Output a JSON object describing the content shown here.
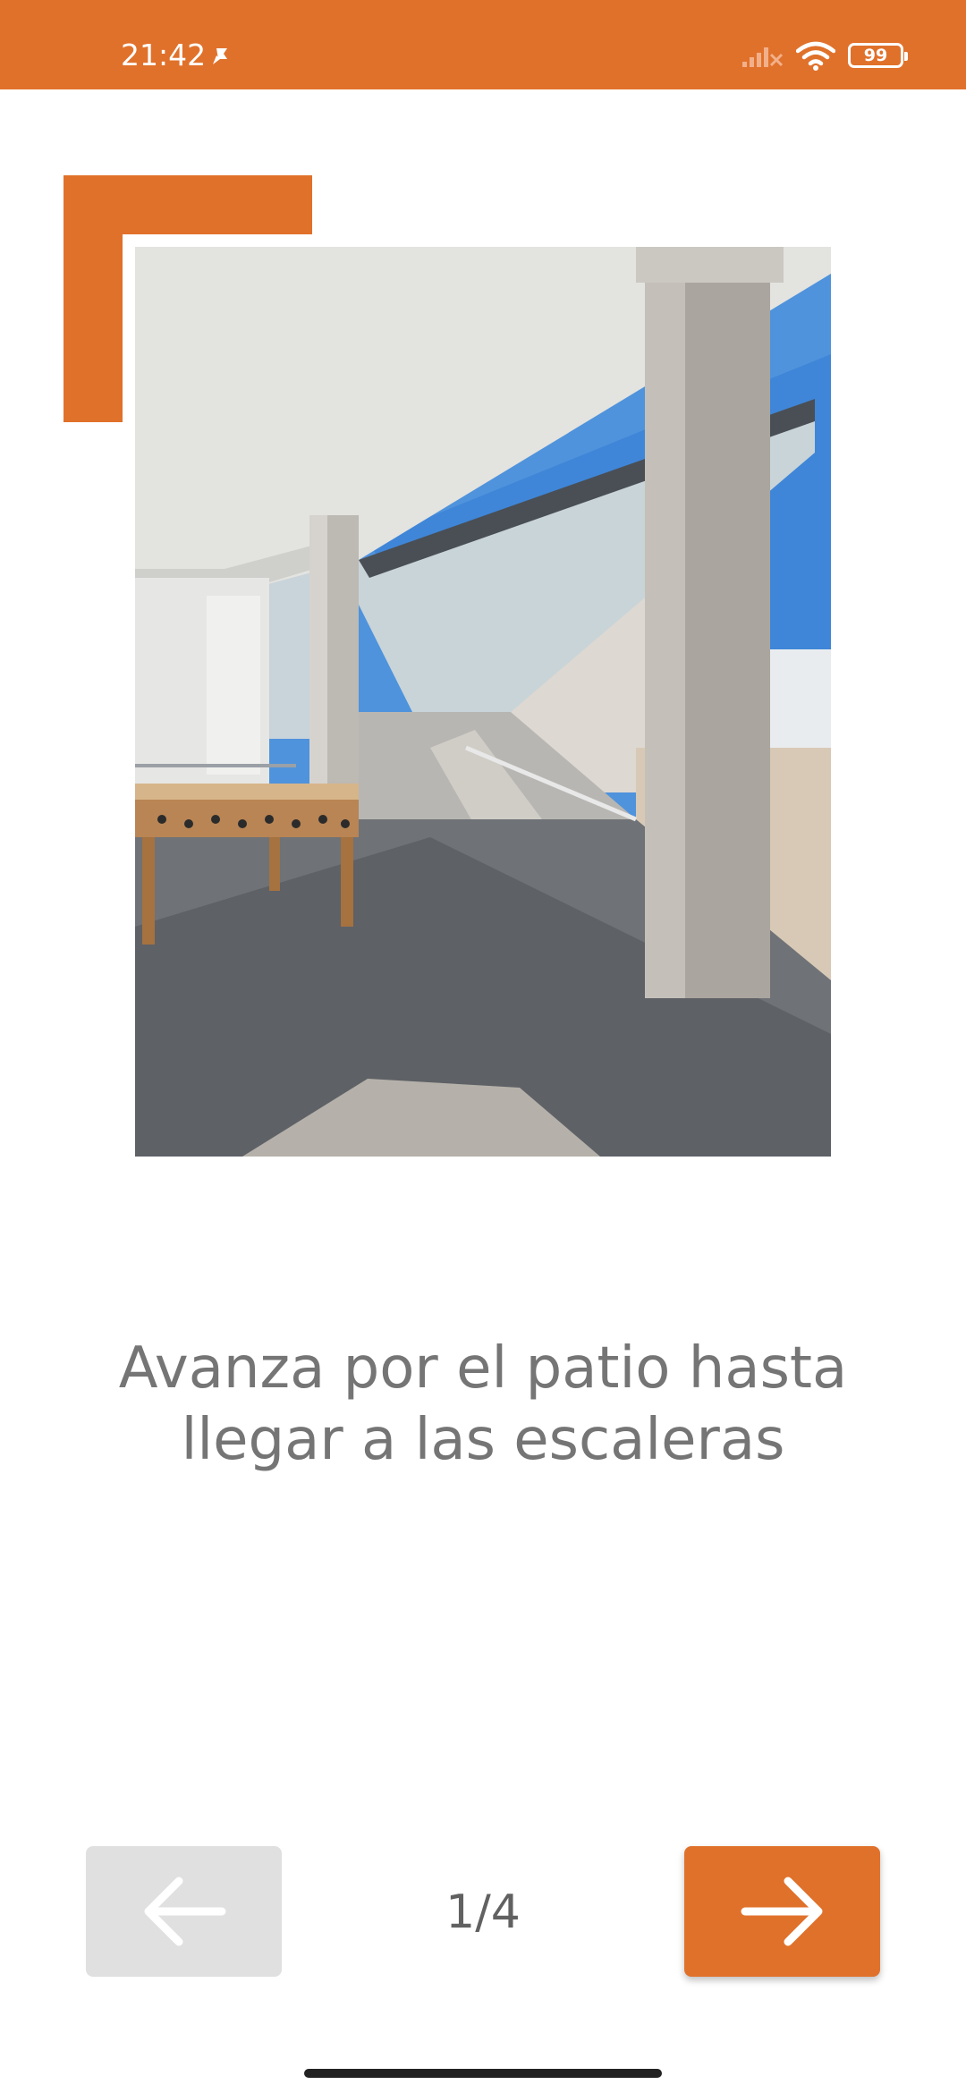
{
  "status_bar": {
    "time": "21:42",
    "battery": "99",
    "icons": [
      "dnd-icon",
      "signal-icon",
      "wifi-icon",
      "battery-icon"
    ]
  },
  "colors": {
    "accent": "#e0712b",
    "disabled": "#e0e0e0",
    "text_muted": "#757575"
  },
  "step": {
    "image_icon": "courtyard-photo",
    "instruction": "Avanza por el patio hasta llegar a las escaleras"
  },
  "navigation": {
    "prev_icon": "arrow-left-icon",
    "next_icon": "arrow-right-icon",
    "page_indicator": "1/4"
  }
}
